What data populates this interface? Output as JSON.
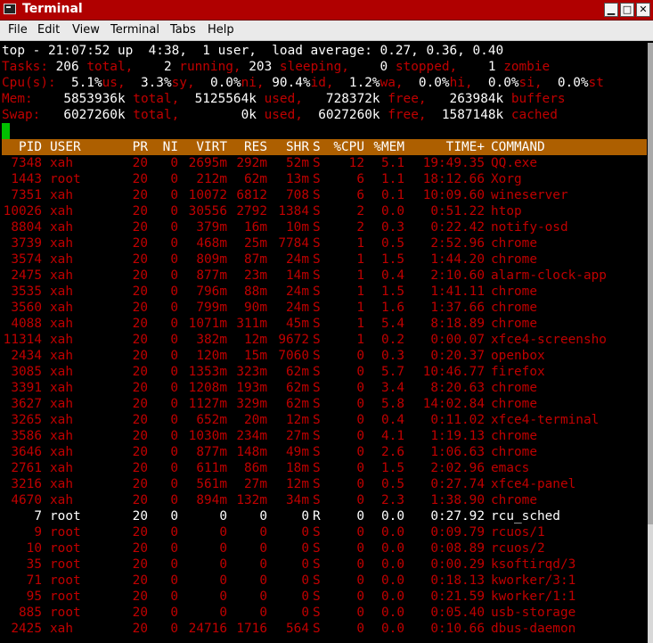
{
  "window": {
    "title": "Terminal",
    "min_glyph": "▁",
    "max_glyph": "□",
    "close_glyph": "✕"
  },
  "menu": [
    "File",
    "Edit",
    "View",
    "Terminal",
    "Tabs",
    "Help"
  ],
  "colors": {
    "titlebar": "#b00000",
    "header_band": "#ad5f00",
    "text_red": "#c00000",
    "cursor": "#00c000"
  },
  "summary": {
    "top_line": "top - 21:07:52 up  4:38,  1 user,  load average: 0.27, 0.36, 0.40",
    "tasks": [
      {
        "t": "Tasks:",
        "c": "r"
      },
      {
        "t": " 206 ",
        "c": "w"
      },
      {
        "t": "total,",
        "c": "r"
      },
      {
        "t": "    2 ",
        "c": "w"
      },
      {
        "t": "running,",
        "c": "r"
      },
      {
        "t": " 203 ",
        "c": "w"
      },
      {
        "t": "sleeping,",
        "c": "r"
      },
      {
        "t": "    0 ",
        "c": "w"
      },
      {
        "t": "stopped,",
        "c": "r"
      },
      {
        "t": "    1 ",
        "c": "w"
      },
      {
        "t": "zombie",
        "c": "r"
      }
    ],
    "cpu": [
      {
        "t": "Cpu(s):",
        "c": "r"
      },
      {
        "t": "  5.1%",
        "c": "w"
      },
      {
        "t": "us,",
        "c": "r"
      },
      {
        "t": "  3.3%",
        "c": "w"
      },
      {
        "t": "sy,",
        "c": "r"
      },
      {
        "t": "  0.0%",
        "c": "w"
      },
      {
        "t": "ni,",
        "c": "r"
      },
      {
        "t": " 90.4%",
        "c": "w"
      },
      {
        "t": "id,",
        "c": "r"
      },
      {
        "t": "  1.2%",
        "c": "w"
      },
      {
        "t": "wa,",
        "c": "r"
      },
      {
        "t": "  0.0%",
        "c": "w"
      },
      {
        "t": "hi,",
        "c": "r"
      },
      {
        "t": "  0.0%",
        "c": "w"
      },
      {
        "t": "si,",
        "c": "r"
      },
      {
        "t": "  0.0%",
        "c": "w"
      },
      {
        "t": "st",
        "c": "r"
      }
    ],
    "mem": [
      {
        "t": "Mem: ",
        "c": "r"
      },
      {
        "t": "   5853936k ",
        "c": "w"
      },
      {
        "t": "total,",
        "c": "r"
      },
      {
        "t": "  5125564k ",
        "c": "w"
      },
      {
        "t": "used,",
        "c": "r"
      },
      {
        "t": "   728372k ",
        "c": "w"
      },
      {
        "t": "free,",
        "c": "r"
      },
      {
        "t": "   263984k ",
        "c": "w"
      },
      {
        "t": "buffers",
        "c": "r"
      }
    ],
    "swap": [
      {
        "t": "Swap:",
        "c": "r"
      },
      {
        "t": "   6027260k ",
        "c": "w"
      },
      {
        "t": "total,",
        "c": "r"
      },
      {
        "t": "        0k ",
        "c": "w"
      },
      {
        "t": "used,",
        "c": "r"
      },
      {
        "t": "  6027260k ",
        "c": "w"
      },
      {
        "t": "free,",
        "c": "r"
      },
      {
        "t": "  1587148k ",
        "c": "w"
      },
      {
        "t": "cached",
        "c": "r"
      }
    ]
  },
  "table": {
    "headers": [
      "PID",
      "USER",
      "PR",
      "NI",
      "VIRT",
      "RES",
      "SHR",
      "S",
      "%CPU",
      "%MEM",
      "TIME+",
      "COMMAND"
    ],
    "rows": [
      {
        "c": "red",
        "v": [
          "7348",
          "xah",
          "20",
          "0",
          "2695m",
          "292m",
          "52m",
          "S",
          "12",
          "5.1",
          "19:49.35",
          "QQ.exe"
        ]
      },
      {
        "c": "red",
        "v": [
          "1443",
          "root",
          "20",
          "0",
          "212m",
          "62m",
          "13m",
          "S",
          "6",
          "1.1",
          "18:12.66",
          "Xorg"
        ]
      },
      {
        "c": "red",
        "v": [
          "7351",
          "xah",
          "20",
          "0",
          "10072",
          "6812",
          "708",
          "S",
          "6",
          "0.1",
          "10:09.60",
          "wineserver"
        ]
      },
      {
        "c": "red",
        "v": [
          "10026",
          "xah",
          "20",
          "0",
          "30556",
          "2792",
          "1384",
          "S",
          "2",
          "0.0",
          "0:51.22",
          "htop"
        ]
      },
      {
        "c": "red",
        "v": [
          "8804",
          "xah",
          "20",
          "0",
          "379m",
          "16m",
          "10m",
          "S",
          "2",
          "0.3",
          "0:22.42",
          "notify-osd"
        ]
      },
      {
        "c": "red",
        "v": [
          "3739",
          "xah",
          "20",
          "0",
          "468m",
          "25m",
          "7784",
          "S",
          "1",
          "0.5",
          "2:52.96",
          "chrome"
        ]
      },
      {
        "c": "red",
        "v": [
          "3574",
          "xah",
          "20",
          "0",
          "809m",
          "87m",
          "24m",
          "S",
          "1",
          "1.5",
          "1:44.20",
          "chrome"
        ]
      },
      {
        "c": "red",
        "v": [
          "2475",
          "xah",
          "20",
          "0",
          "877m",
          "23m",
          "14m",
          "S",
          "1",
          "0.4",
          "2:10.60",
          "alarm-clock-app"
        ]
      },
      {
        "c": "red",
        "v": [
          "3535",
          "xah",
          "20",
          "0",
          "796m",
          "88m",
          "24m",
          "S",
          "1",
          "1.5",
          "1:41.11",
          "chrome"
        ]
      },
      {
        "c": "red",
        "v": [
          "3560",
          "xah",
          "20",
          "0",
          "799m",
          "90m",
          "24m",
          "S",
          "1",
          "1.6",
          "1:37.66",
          "chrome"
        ]
      },
      {
        "c": "red",
        "v": [
          "4088",
          "xah",
          "20",
          "0",
          "1071m",
          "311m",
          "45m",
          "S",
          "1",
          "5.4",
          "8:18.89",
          "chrome"
        ]
      },
      {
        "c": "red",
        "v": [
          "11314",
          "xah",
          "20",
          "0",
          "382m",
          "12m",
          "9672",
          "S",
          "1",
          "0.2",
          "0:00.07",
          "xfce4-screensho"
        ]
      },
      {
        "c": "red",
        "v": [
          "2434",
          "xah",
          "20",
          "0",
          "120m",
          "15m",
          "7060",
          "S",
          "0",
          "0.3",
          "0:20.37",
          "openbox"
        ]
      },
      {
        "c": "red",
        "v": [
          "3085",
          "xah",
          "20",
          "0",
          "1353m",
          "323m",
          "62m",
          "S",
          "0",
          "5.7",
          "10:46.77",
          "firefox"
        ]
      },
      {
        "c": "red",
        "v": [
          "3391",
          "xah",
          "20",
          "0",
          "1208m",
          "193m",
          "62m",
          "S",
          "0",
          "3.4",
          "8:20.63",
          "chrome"
        ]
      },
      {
        "c": "red",
        "v": [
          "3627",
          "xah",
          "20",
          "0",
          "1127m",
          "329m",
          "62m",
          "S",
          "0",
          "5.8",
          "14:02.84",
          "chrome"
        ]
      },
      {
        "c": "red",
        "v": [
          "3265",
          "xah",
          "20",
          "0",
          "652m",
          "20m",
          "12m",
          "S",
          "0",
          "0.4",
          "0:11.02",
          "xfce4-terminal"
        ]
      },
      {
        "c": "red",
        "v": [
          "3586",
          "xah",
          "20",
          "0",
          "1030m",
          "234m",
          "27m",
          "S",
          "0",
          "4.1",
          "1:19.13",
          "chrome"
        ]
      },
      {
        "c": "red",
        "v": [
          "3646",
          "xah",
          "20",
          "0",
          "877m",
          "148m",
          "49m",
          "S",
          "0",
          "2.6",
          "1:06.63",
          "chrome"
        ]
      },
      {
        "c": "red",
        "v": [
          "2761",
          "xah",
          "20",
          "0",
          "611m",
          "86m",
          "18m",
          "S",
          "0",
          "1.5",
          "2:02.96",
          "emacs"
        ]
      },
      {
        "c": "red",
        "v": [
          "3216",
          "xah",
          "20",
          "0",
          "561m",
          "27m",
          "12m",
          "S",
          "0",
          "0.5",
          "0:27.74",
          "xfce4-panel"
        ]
      },
      {
        "c": "red",
        "v": [
          "4670",
          "xah",
          "20",
          "0",
          "894m",
          "132m",
          "34m",
          "S",
          "0",
          "2.3",
          "1:38.90",
          "chrome"
        ]
      },
      {
        "c": "white",
        "v": [
          "7",
          "root",
          "20",
          "0",
          "0",
          "0",
          "0",
          "R",
          "0",
          "0.0",
          "0:27.92",
          "rcu_sched"
        ]
      },
      {
        "c": "red",
        "v": [
          "9",
          "root",
          "20",
          "0",
          "0",
          "0",
          "0",
          "S",
          "0",
          "0.0",
          "0:09.79",
          "rcuos/1"
        ]
      },
      {
        "c": "red",
        "v": [
          "10",
          "root",
          "20",
          "0",
          "0",
          "0",
          "0",
          "S",
          "0",
          "0.0",
          "0:08.89",
          "rcuos/2"
        ]
      },
      {
        "c": "red",
        "v": [
          "35",
          "root",
          "20",
          "0",
          "0",
          "0",
          "0",
          "S",
          "0",
          "0.0",
          "0:00.29",
          "ksoftirqd/3"
        ]
      },
      {
        "c": "red",
        "v": [
          "71",
          "root",
          "20",
          "0",
          "0",
          "0",
          "0",
          "S",
          "0",
          "0.0",
          "0:18.13",
          "kworker/3:1"
        ]
      },
      {
        "c": "red",
        "v": [
          "95",
          "root",
          "20",
          "0",
          "0",
          "0",
          "0",
          "S",
          "0",
          "0.0",
          "0:21.59",
          "kworker/1:1"
        ]
      },
      {
        "c": "red",
        "v": [
          "885",
          "root",
          "20",
          "0",
          "0",
          "0",
          "0",
          "S",
          "0",
          "0.0",
          "0:05.40",
          "usb-storage"
        ]
      },
      {
        "c": "red",
        "v": [
          "2425",
          "xah",
          "20",
          "0",
          "24716",
          "1716",
          "564",
          "S",
          "0",
          "0.0",
          "0:10.66",
          "dbus-daemon"
        ]
      }
    ]
  }
}
